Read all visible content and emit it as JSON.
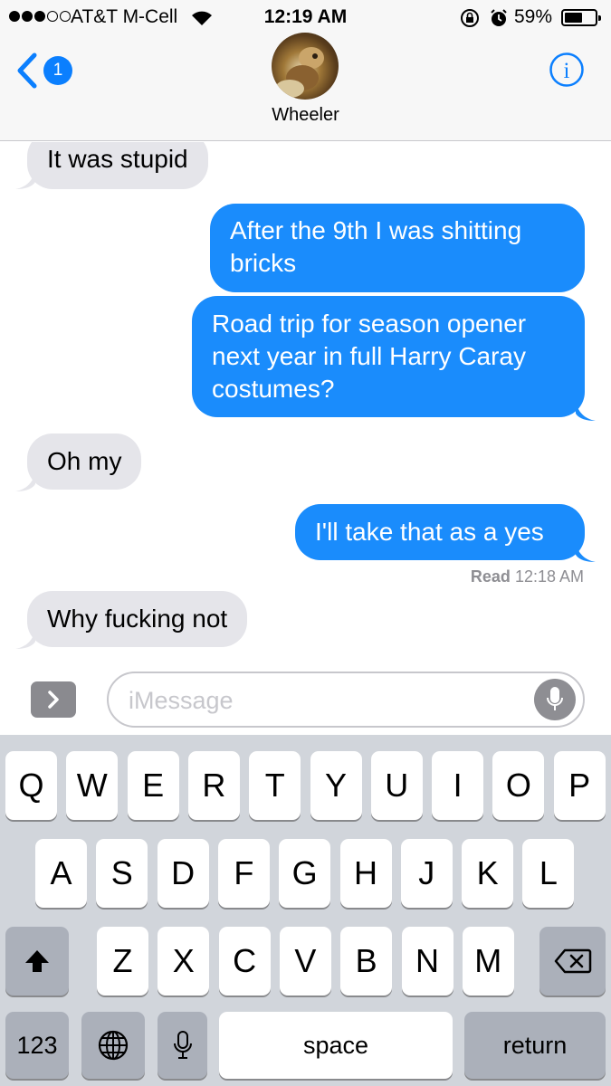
{
  "status_bar": {
    "carrier": "AT&T M-Cell",
    "time": "12:19 AM",
    "battery": "59%",
    "battery_level": 0.59,
    "signal_bars": 3,
    "signal_total": 5
  },
  "nav": {
    "back_badge": "1",
    "contact_name": "Wheeler",
    "info_label": "i"
  },
  "messages": [
    {
      "direction": "incoming",
      "text": "It was stupid"
    },
    {
      "direction": "outgoing",
      "lines": [
        "After the 9th I was shitting",
        "bricks"
      ]
    },
    {
      "direction": "outgoing",
      "lines": [
        "Road trip for season opener",
        "next year in full Harry Caray",
        "costumes?"
      ]
    },
    {
      "direction": "incoming",
      "text": "Oh my"
    },
    {
      "direction": "outgoing",
      "text": "I'll take that as a yes"
    },
    {
      "direction": "incoming",
      "text": "Why fucking not"
    }
  ],
  "receipt": {
    "label": "Read",
    "time": "12:18 AM"
  },
  "input": {
    "placeholder": "iMessage",
    "value": ""
  },
  "keyboard": {
    "row1": [
      "Q",
      "W",
      "E",
      "R",
      "T",
      "Y",
      "U",
      "I",
      "O",
      "P"
    ],
    "row2": [
      "A",
      "S",
      "D",
      "F",
      "G",
      "H",
      "J",
      "K",
      "L"
    ],
    "row3": [
      "Z",
      "X",
      "C",
      "V",
      "B",
      "N",
      "M"
    ],
    "numbers_label": "123",
    "space_label": "space",
    "return_label": "return"
  },
  "colors": {
    "accent": "#0b7ffe",
    "outgoing_bubble": "#1a8cfc",
    "incoming_bubble": "#e5e5ea",
    "keyboard_bg": "#d1d5db"
  }
}
